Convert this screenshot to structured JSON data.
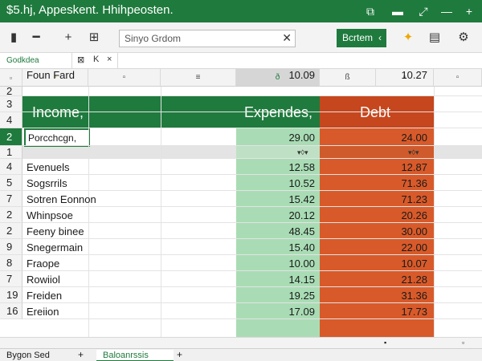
{
  "window": {
    "title": "$5.hj, Appeskent. Hhihpeosten.",
    "controls": [
      "window-icon",
      "folder-icon",
      "minimize-icon",
      "add-icon"
    ]
  },
  "ribbon": {
    "search_placeholder": "Sinyo Grdom",
    "action_button": "Bcrtem",
    "accent_color": "#1f7a3d"
  },
  "formula_bar": {
    "name_box": "Godkdea"
  },
  "columns": [
    "▫",
    "▫",
    "▫",
    "≡",
    "",
    "ð",
    "ß",
    "▫",
    "▫"
  ],
  "row_numbers": [
    "2",
    "3",
    "4",
    "2",
    "1",
    "4",
    "5",
    "7",
    "2",
    "2",
    "9",
    "8",
    "7",
    "19",
    "16"
  ],
  "header": {
    "income": "Income,",
    "expenses": "Expendes,",
    "debt": "Debt",
    "green": "#1f7a3d",
    "red": "#c6461d"
  },
  "active_cell": "Porcchcgn,",
  "summary": {
    "expenses": "29.00",
    "debt": "24.00"
  },
  "rows": [
    {
      "name": "Evenuels",
      "expense": "12.58",
      "debt": "12.87"
    },
    {
      "name": "Sogsrrils",
      "expense": "10.52",
      "debt": "71.36"
    },
    {
      "name": "Sotren Eonnon",
      "expense": "15.42",
      "debt": "71.23"
    },
    {
      "name": "Whinpsoe",
      "expense": "20.12",
      "debt": "20.26"
    },
    {
      "name": "Feeny binee",
      "expense": "48.45",
      "debt": "30.00"
    },
    {
      "name": "Snegermain",
      "expense": "15.40",
      "debt": "22.00"
    },
    {
      "name": "Fraope",
      "expense": "10.00",
      "debt": "10.07"
    },
    {
      "name": "Rowiiol",
      "expense": "14.15",
      "debt": "21.28"
    },
    {
      "name": "Freiden",
      "expense": "19.25",
      "debt": "31.36"
    },
    {
      "name": "Ereiion",
      "expense": "17.09",
      "debt": "17.73"
    },
    {
      "name": "Foun Fard",
      "expense": "10.09",
      "debt": "10.27"
    }
  ],
  "sheets": [
    "Bygon Sed",
    "Baloanrssis"
  ]
}
